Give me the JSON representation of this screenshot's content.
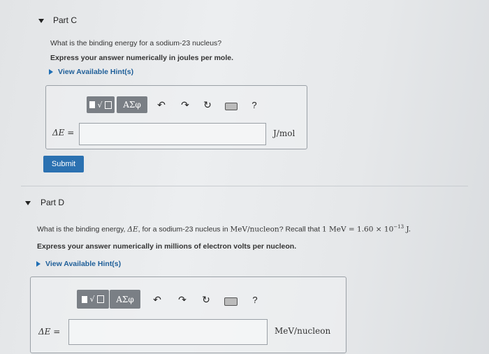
{
  "partC": {
    "title": "Part C",
    "question": "What is the binding energy for a sodium-23 nucleus?",
    "instruction": "Express your answer numerically in joules per mole.",
    "hint_link": "View Available Hint(s)",
    "toolbar": {
      "template_label": "√",
      "greek_label": "ΑΣφ",
      "help_label": "?"
    },
    "answer_label": "ΔE =",
    "answer_value": "",
    "unit": "J/mol",
    "submit_label": "Submit"
  },
  "partD": {
    "title": "Part D",
    "question_prefix": "What is the binding energy,",
    "question_symbol": "ΔE",
    "question_middle": ", for a sodium-23 nucleus in",
    "question_unit": "MeV/nucleon",
    "question_recall": "? Recall that",
    "question_equation": "1 MeV = 1.60 × 10",
    "question_exponent": "−13",
    "question_end": " J.",
    "instruction": "Express your answer numerically in millions of electron volts per nucleon.",
    "hint_link": "View Available Hint(s)",
    "toolbar": {
      "template_label": "√",
      "greek_label": "ΑΣφ",
      "help_label": "?"
    },
    "answer_label": "ΔE =",
    "answer_value": "",
    "unit": "MeV/nucleon"
  },
  "icons": {
    "undo": "↶",
    "redo": "↷",
    "reset": "↻"
  }
}
